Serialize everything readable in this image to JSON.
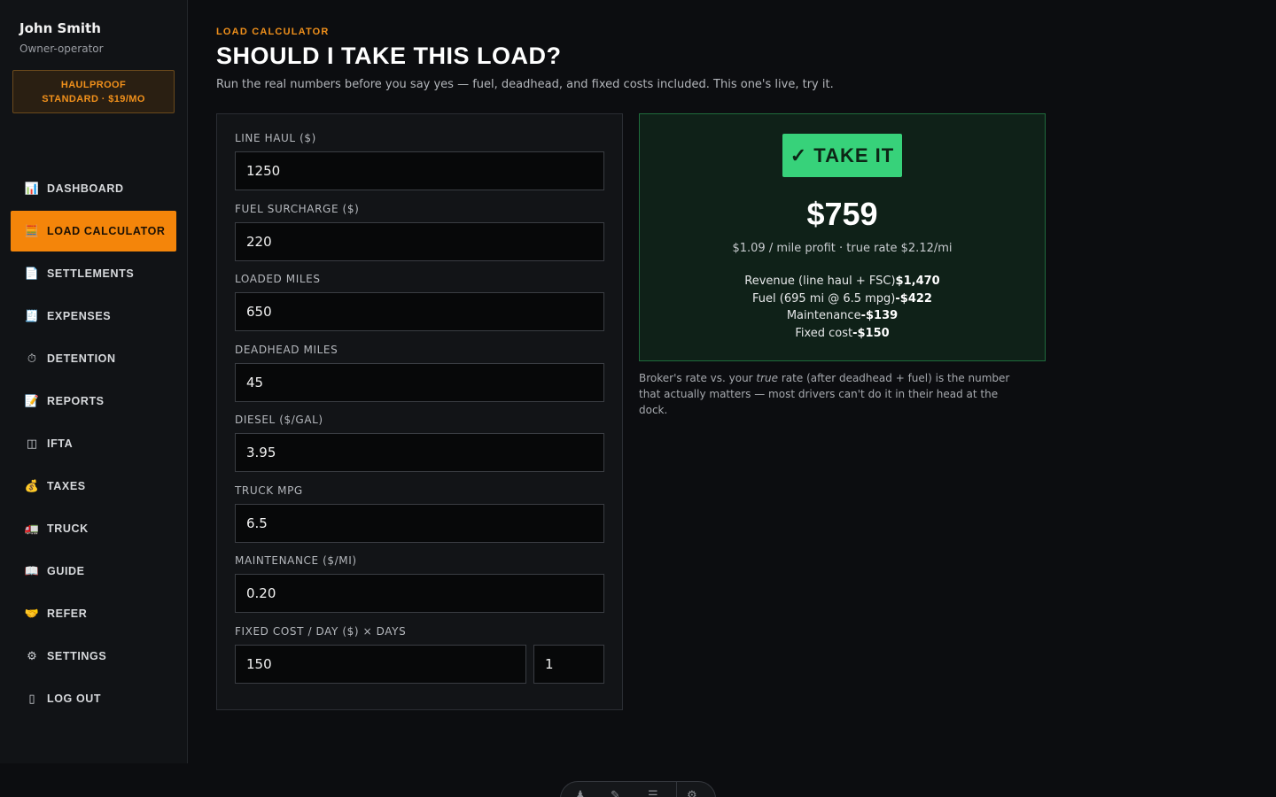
{
  "sidebar": {
    "user_name": "John Smith",
    "user_role": "Owner-operator",
    "plan_badge": "HAULPROOF STANDARD · $19/MO",
    "items": [
      {
        "label": "DASHBOARD",
        "icon": "bar-chart-icon",
        "glyph": "📊",
        "active": false
      },
      {
        "label": "LOAD CALCULATOR",
        "icon": "abacus-icon",
        "glyph": "🧮",
        "active": true
      },
      {
        "label": "SETTLEMENTS",
        "icon": "document-icon",
        "glyph": "📄",
        "active": false
      },
      {
        "label": "EXPENSES",
        "icon": "receipt-icon",
        "glyph": "🧾",
        "active": false
      },
      {
        "label": "DETENTION",
        "icon": "stopwatch-icon",
        "glyph": "⏱",
        "active": false
      },
      {
        "label": "REPORTS",
        "icon": "report-icon",
        "glyph": "📝",
        "active": false
      },
      {
        "label": "IFTA",
        "icon": "columns-icon",
        "glyph": "◫",
        "active": false
      },
      {
        "label": "TAXES",
        "icon": "money-bag-icon",
        "glyph": "💰",
        "active": false
      },
      {
        "label": "TRUCK",
        "icon": "truck-icon",
        "glyph": "🚛",
        "active": false
      },
      {
        "label": "GUIDE",
        "icon": "book-icon",
        "glyph": "📖",
        "active": false
      },
      {
        "label": "REFER",
        "icon": "handshake-icon",
        "glyph": "🤝",
        "active": false
      },
      {
        "label": "SETTINGS",
        "icon": "gear-icon",
        "glyph": "⚙",
        "active": false
      },
      {
        "label": "LOG OUT",
        "icon": "door-icon",
        "glyph": "▯",
        "active": false
      }
    ]
  },
  "header": {
    "eyebrow": "LOAD CALCULATOR",
    "title": "SHOULD I TAKE THIS LOAD?",
    "subtitle": "Run the real numbers before you say yes — fuel, deadhead, and fixed costs included. This one's live, try it."
  },
  "form": {
    "line_haul": {
      "label": "LINE HAUL ($)",
      "value": "1250"
    },
    "fuel_surcharge": {
      "label": "FUEL SURCHARGE ($)",
      "value": "220"
    },
    "loaded_miles": {
      "label": "LOADED MILES",
      "value": "650"
    },
    "deadhead_miles": {
      "label": "DEADHEAD MILES",
      "value": "45"
    },
    "diesel": {
      "label": "DIESEL ($/GAL)",
      "value": "3.95"
    },
    "truck_mpg": {
      "label": "TRUCK MPG",
      "value": "6.5"
    },
    "maintenance": {
      "label": "MAINTENANCE ($/MI)",
      "value": "0.20"
    },
    "fixed_cost": {
      "label": "FIXED COST / DAY ($) × DAYS",
      "value": "150",
      "days": "1"
    }
  },
  "result": {
    "verdict": "✓ TAKE IT",
    "profit": "$759",
    "profit_sub": "$1.09 / mile profit · true rate $2.12/mi",
    "breakdown": [
      {
        "label": "Revenue (line haul + FSC)",
        "value": "$1,470"
      },
      {
        "label": "Fuel (695 mi @ 6.5 mpg)",
        "value": "-$422"
      },
      {
        "label": "Maintenance",
        "value": "-$139"
      },
      {
        "label": "Fixed cost",
        "value": "-$150"
      }
    ]
  },
  "note": {
    "before": "Broker's rate vs. your ",
    "emphasis": "true",
    "after": " rate (after deadhead + fuel) is the number that actually matters — most drivers can't do it in their head at the dock."
  },
  "colors": {
    "accent": "#f4850a",
    "success": "#37d27a",
    "background": "#0c0d10"
  }
}
